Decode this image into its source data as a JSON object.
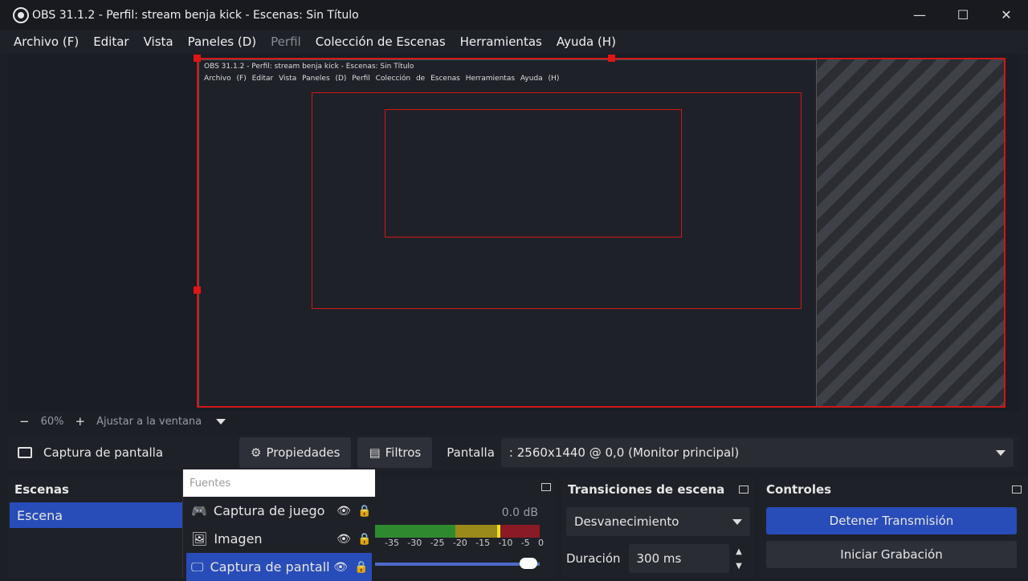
{
  "window": {
    "title": "OBS 31.1.2 - Perfil: stream benja kick - Escenas: Sin Título",
    "minimize": "—",
    "maximize": "☐",
    "close": "✕"
  },
  "menu": {
    "items": [
      "Archivo (F)",
      "Editar",
      "Vista",
      "Paneles (D)",
      "Perfil",
      "Colección de Escenas",
      "Herramientas",
      "Ayuda (H)"
    ]
  },
  "preview": {
    "inner_title": "OBS 31.1.2 - Perfil: stream benja kick - Escenas: Sin Título",
    "inner_menu": "Archivo (F) Editar Vista Paneles (D) Perfil Colección de Escenas Herramientas Ayuda (H)"
  },
  "zoom": {
    "minus": "−",
    "level": "60%",
    "plus": "+",
    "fit": "Ajustar a la ventana"
  },
  "source_toolbar": {
    "source_name": "Captura de pantalla",
    "properties": "Propiedades",
    "filters": "Filtros",
    "display_label": "Pantalla",
    "display_value": ": 2560x1440 @ 0,0 (Monitor principal)"
  },
  "scenes": {
    "title": "Escenas",
    "items": [
      "Escena"
    ]
  },
  "sources": {
    "filter_placeholder": "Fuentes",
    "items": [
      {
        "name": "Captura de juego",
        "icon": "gamepad-icon"
      },
      {
        "name": "Imagen",
        "icon": "image-icon"
      },
      {
        "name": "Captura de pantall",
        "icon": "monitor-icon"
      }
    ]
  },
  "mixer": {
    "db": "0.0 dB",
    "scale": [
      "-35",
      "-30",
      "-25",
      "-20",
      "-15",
      "-10",
      "-5",
      "0"
    ]
  },
  "transitions": {
    "title": "Transiciones de escena",
    "selected": "Desvanecimiento",
    "duration_label": "Duración",
    "duration_value": "300 ms"
  },
  "controls": {
    "title": "Controles",
    "stop_stream": "Detener Transmisión",
    "start_record": "Iniciar Grabación"
  },
  "colors": {
    "accent": "#284cb8",
    "selection_border": "#d01717",
    "background": "#1d1f26"
  }
}
